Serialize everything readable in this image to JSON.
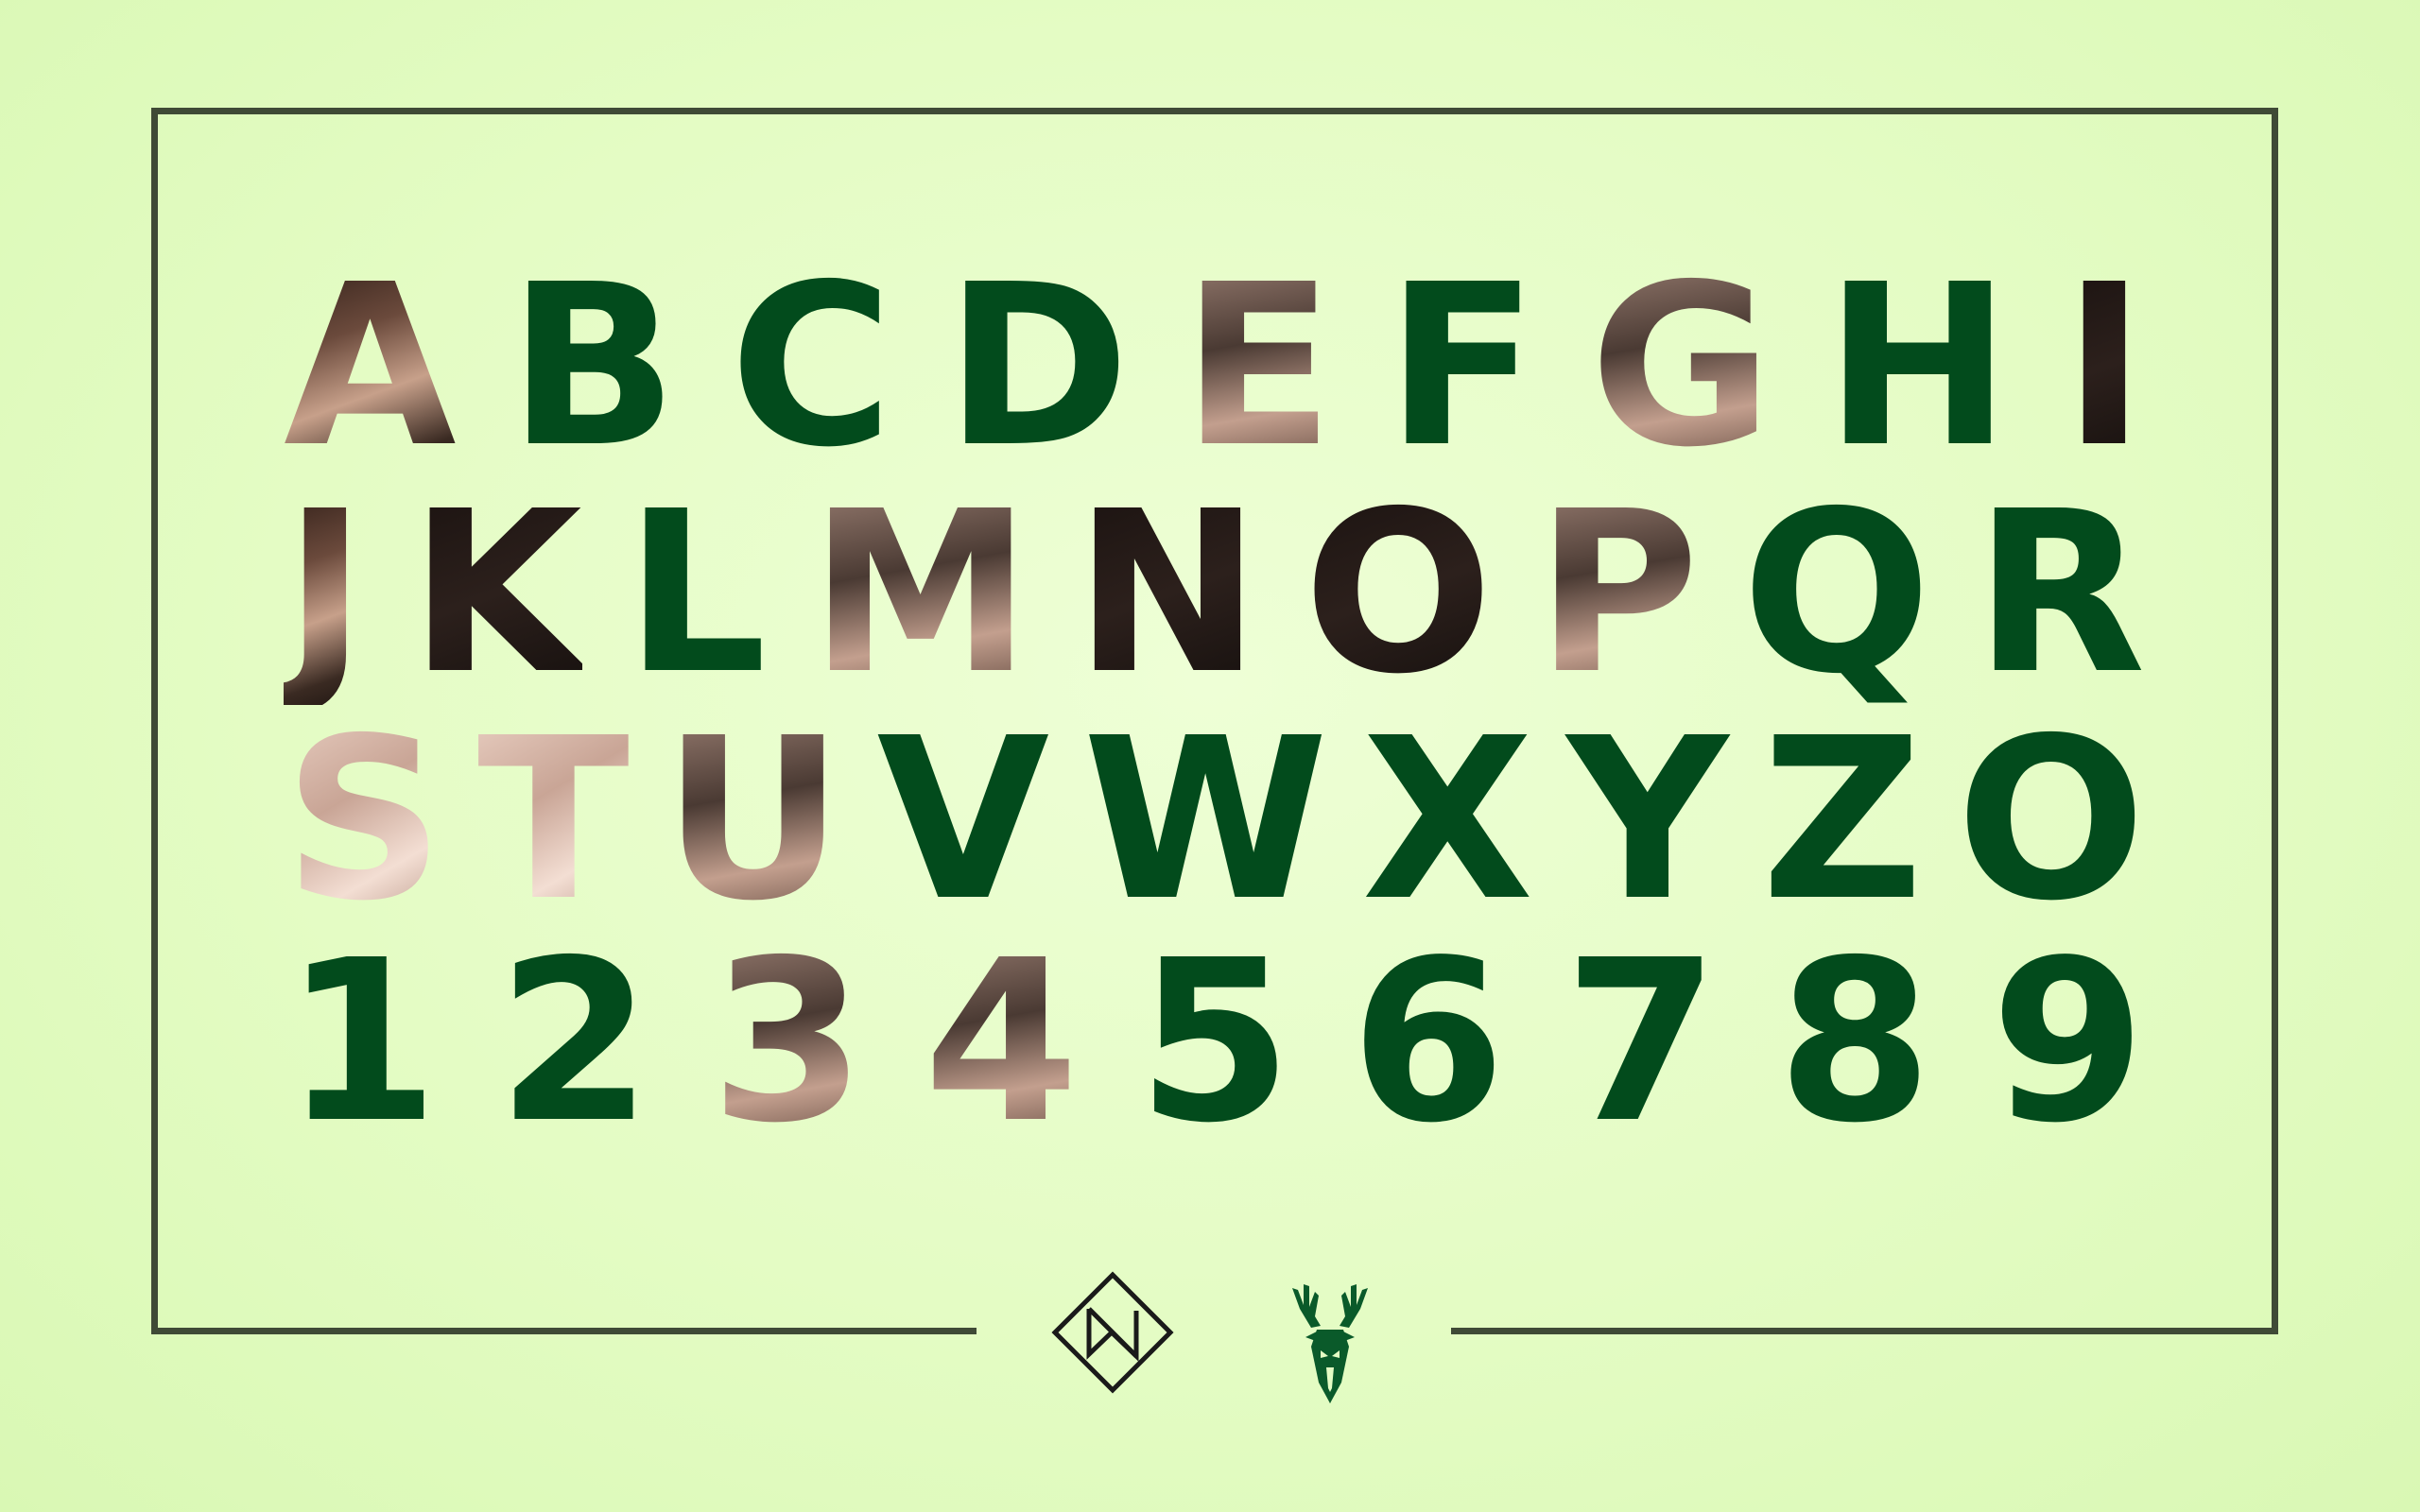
{
  "rows": [
    [
      "A",
      "B",
      "C",
      "D",
      "E",
      "F",
      "G",
      "H",
      "I"
    ],
    [
      "J",
      "K",
      "L",
      "M",
      "N",
      "O",
      "P",
      "Q",
      "R"
    ],
    [
      "S",
      "T",
      "U",
      "V",
      "W",
      "X",
      "Y",
      "Z",
      "O"
    ],
    [
      "1",
      "2",
      "3",
      "4",
      "5",
      "6",
      "7",
      "8",
      "9"
    ]
  ],
  "photo_fill": {
    "A": "photo",
    "E": "photo mid",
    "G": "photo mid",
    "I": "photo dark",
    "J": "photo",
    "K": "photo dark",
    "M": "photo mid",
    "N": "photo dark",
    "O_2": "photo dark",
    "P": "photo mid",
    "S": "photo light",
    "T": "photo light",
    "U": "photo mid",
    "3": "photo mid",
    "4": "photo mid"
  },
  "colors": {
    "background": "#e4fcc4",
    "letter_green": "#024b1c",
    "frame": "#3f4a36"
  },
  "logos": {
    "designer_icon": "diamond-monogram-icon",
    "team_icon": "deer-head-icon"
  }
}
